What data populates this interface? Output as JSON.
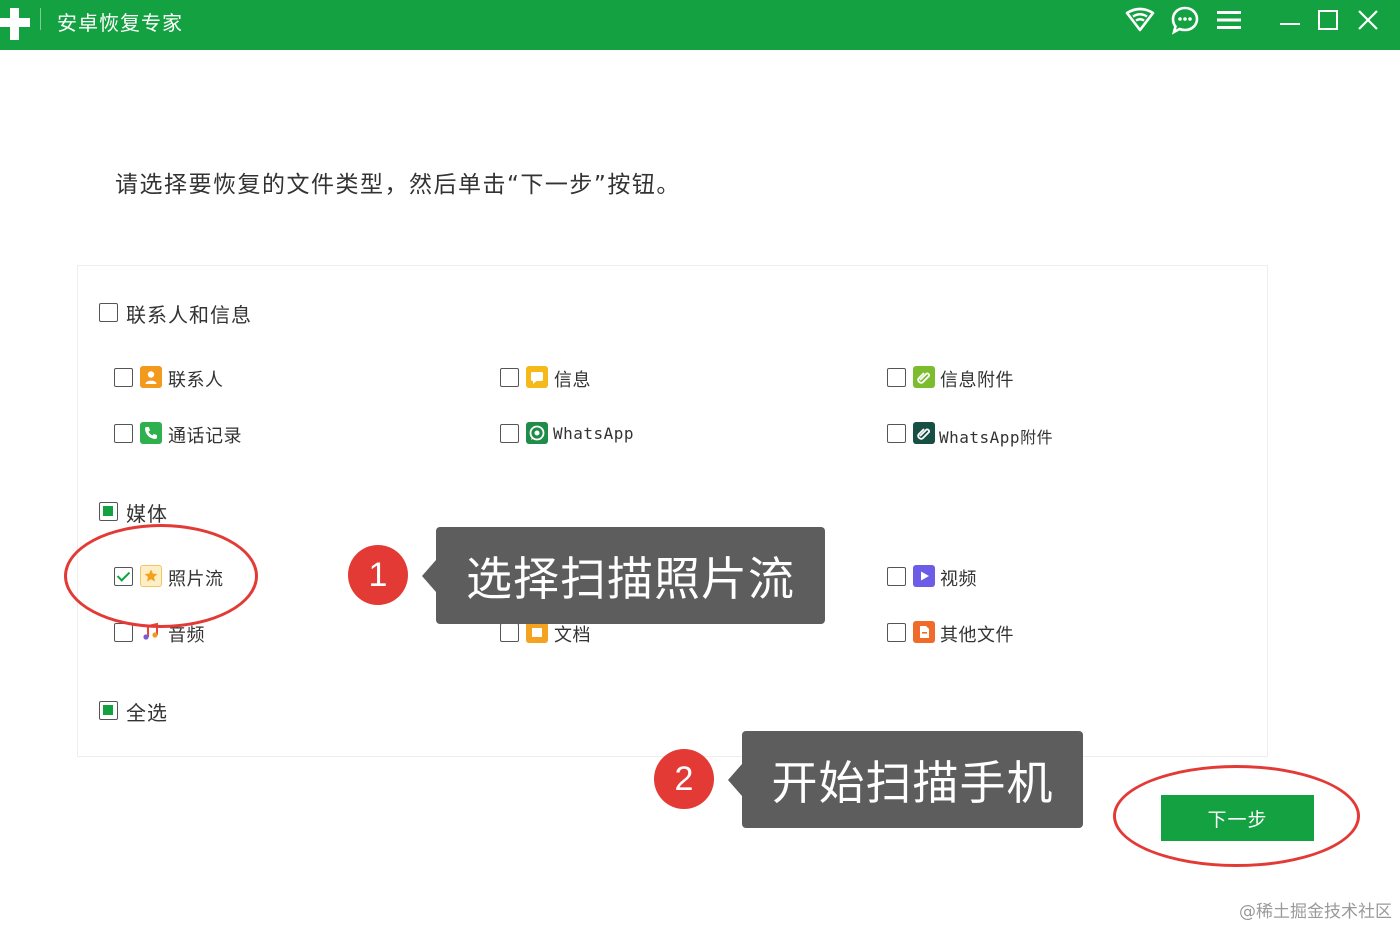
{
  "window": {
    "title": "安卓恢复专家",
    "accent_color": "#14a141",
    "controls": [
      "wifi-icon",
      "chat-icon",
      "menu-icon",
      "minimize-icon",
      "maximize-icon",
      "close-icon"
    ]
  },
  "instruction": "请选择要恢复的文件类型，然后单击“下一步”按钮。",
  "groups": {
    "contacts_messages": {
      "label": "联系人和信息",
      "state": "unchecked",
      "items": [
        {
          "label": "联系人",
          "checked": false,
          "icon": "contact-icon"
        },
        {
          "label": "信息",
          "checked": false,
          "icon": "message-icon"
        },
        {
          "label": "信息附件",
          "checked": false,
          "icon": "attachment-icon"
        },
        {
          "label": "通话记录",
          "checked": false,
          "icon": "phone-icon"
        },
        {
          "label": "WhatsApp",
          "checked": false,
          "icon": "whatsapp-icon"
        },
        {
          "label": "WhatsApp附件",
          "checked": false,
          "icon": "whatsapp-attachment-icon"
        }
      ]
    },
    "media": {
      "label": "媒体",
      "state": "partial",
      "items": [
        {
          "label": "照片流",
          "checked": true,
          "icon": "photo-stream-icon"
        },
        {
          "label": "视频",
          "checked": false,
          "icon": "video-icon"
        },
        {
          "label": "音频",
          "checked": false,
          "icon": "audio-icon"
        },
        {
          "label": "文档",
          "checked": false,
          "icon": "document-icon"
        },
        {
          "label": "其他文件",
          "checked": false,
          "icon": "other-file-icon"
        }
      ]
    }
  },
  "select_all": {
    "label": "全选",
    "state": "partial"
  },
  "annotations": [
    {
      "number": "1",
      "text": "选择扫描照片流"
    },
    {
      "number": "2",
      "text": "开始扫描手机"
    }
  ],
  "next_button": "下一步",
  "watermark": "@稀土掘金技术社区"
}
